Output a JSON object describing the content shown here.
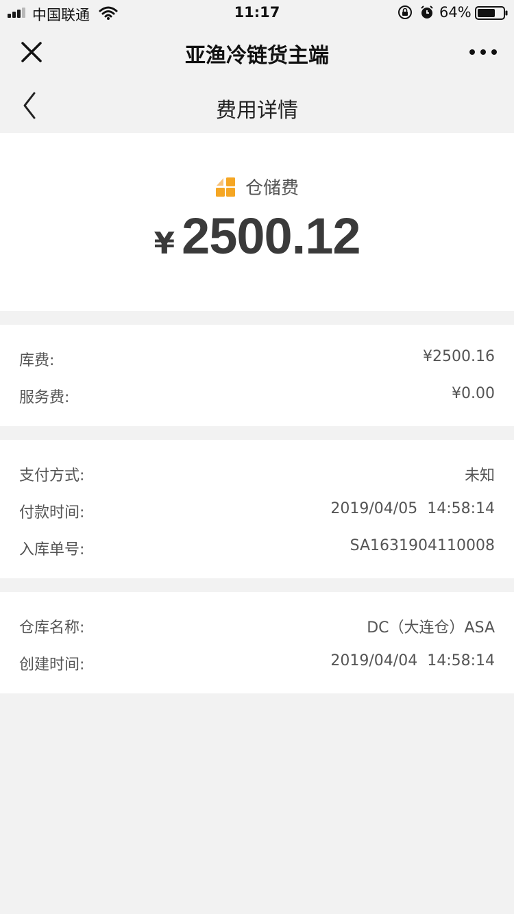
{
  "status_bar": {
    "carrier": "中国联通",
    "time": "11:17",
    "battery": "64%"
  },
  "app_header": {
    "title": "亚渔冷链货主端",
    "close_icon": "close-icon",
    "more_icon": "more-icon"
  },
  "page_nav": {
    "title": "费用详情",
    "back_icon": "back-chevron-icon"
  },
  "summary": {
    "fee_type": "仓储费",
    "fee_icon": "storage-fee-icon",
    "currency_symbol": "¥",
    "amount": "2500.12",
    "icon_color": "#f5a623"
  },
  "fees": [
    {
      "label": "库费:",
      "value": "¥2500.16"
    },
    {
      "label": "服务费:",
      "value": "¥0.00"
    }
  ],
  "payment": [
    {
      "label": "支付方式:",
      "value": "未知"
    },
    {
      "label": "付款时间:",
      "value": "2019/04/05  14:58:14"
    },
    {
      "label": "入库单号:",
      "value": "SA1631904110008"
    }
  ],
  "warehouse": [
    {
      "label": "仓库名称:",
      "value": "DC（大连仓）ASA"
    },
    {
      "label": "创建时间:",
      "value": "2019/04/04  14:58:14"
    }
  ]
}
